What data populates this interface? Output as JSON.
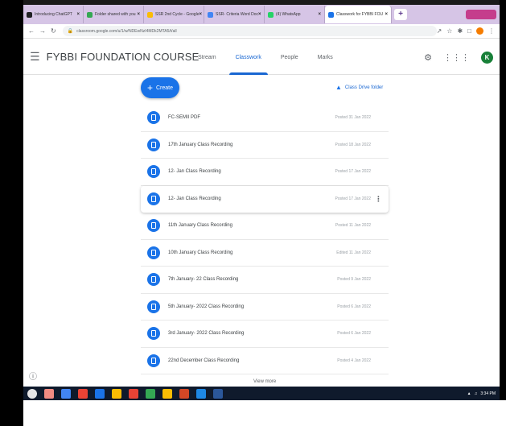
{
  "browser": {
    "tabs": [
      {
        "label": "Introducing ChatGPT",
        "fav_color": "#202124"
      },
      {
        "label": "Folder shared with you",
        "fav_color": "#34a853"
      },
      {
        "label": "SSR 2nd Cycle - Google",
        "fav_color": "#fbbc04"
      },
      {
        "label": "SSR- Criteria Word Doc",
        "fav_color": "#4285f4"
      },
      {
        "label": "(4) WhatsApp",
        "fav_color": "#25d366"
      },
      {
        "label": "Classwork for FYBBI FOU",
        "fav_color": "#1a73e8",
        "active": true
      }
    ],
    "new_tab": "+",
    "url": "classroom.google.com/u/1/w/NDEwNzI4MDk2MTA5/t/all"
  },
  "header": {
    "course_title": "FYBBI FOUNDATION COURSE",
    "nav": [
      {
        "label": "Stream",
        "active": false
      },
      {
        "label": "Classwork",
        "active": true
      },
      {
        "label": "People",
        "active": false
      },
      {
        "label": "Marks",
        "active": false
      }
    ],
    "avatar_initial": "K"
  },
  "toolbar": {
    "create_label": "Create",
    "drive_folder_label": "Class Drive folder"
  },
  "materials": [
    {
      "title": "FC-SEMII PDF",
      "date": "Posted 31 Jan 2022"
    },
    {
      "title": "17th January Class Recording",
      "date": "Posted 18 Jan 2022"
    },
    {
      "title": "12- Jan Class Recording",
      "date": "Posted 17 Jan 2022"
    },
    {
      "title": "12- Jan Class Recording",
      "date": "Posted 17 Jan 2022",
      "hovered": true
    },
    {
      "title": "11th January Class Recording",
      "date": "Posted 11 Jan 2022"
    },
    {
      "title": "10th January Class Recording",
      "date": "Edited 11 Jan 2022"
    },
    {
      "title": "7th January- 22 Class Recording",
      "date": "Posted 9 Jan 2022"
    },
    {
      "title": "5th January- 2022 Class Recording",
      "date": "Posted 6 Jan 2022"
    },
    {
      "title": "3rd January- 2022 Class Recording",
      "date": "Posted 6 Jan 2022"
    },
    {
      "title": "22nd December Class Recording",
      "date": "Posted 4 Jan 2022"
    }
  ],
  "footer": {
    "view_more": "View more"
  },
  "taskbar": {
    "apps": [
      "#f28b82",
      "#4285f4",
      "#ea4335",
      "#1a73e8",
      "#fbbc04",
      "#ea4335",
      "#34a853",
      "#fbbc04",
      "#d24726",
      "#1e88e5",
      "#2b579a"
    ],
    "time": "3:34 PM"
  }
}
